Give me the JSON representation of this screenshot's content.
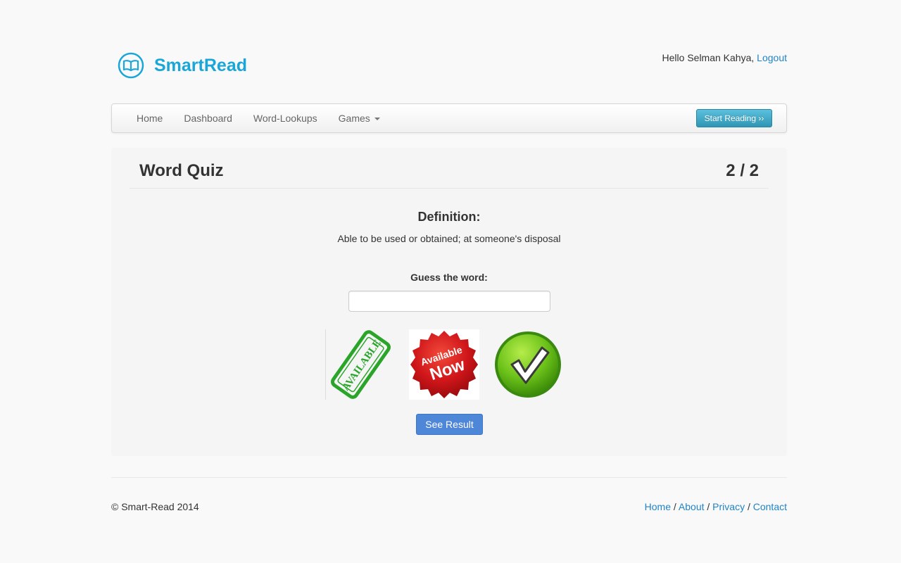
{
  "brand": {
    "name": "SmartRead",
    "icon": "open-book-icon",
    "color": "#1aa6d8"
  },
  "user": {
    "greeting": "Hello Selman Kahya,",
    "logout_label": "Logout"
  },
  "nav": {
    "items": [
      {
        "label": "Home"
      },
      {
        "label": "Dashboard"
      },
      {
        "label": "Word-Lookups"
      },
      {
        "label": "Games"
      }
    ],
    "start_button": "Start Reading ››"
  },
  "quiz": {
    "title": "Word Quiz",
    "progress": "2 / 2",
    "definition_label": "Definition:",
    "definition_text": "Able to be used or obtained; at someone's disposal",
    "guess_label": "Guess the word:",
    "guess_value": "",
    "images": [
      {
        "icon": "available-stamp-icon",
        "text": "AVAILABLE"
      },
      {
        "icon": "available-now-badge-icon",
        "text_top": "Available",
        "text_bottom": "Now"
      },
      {
        "icon": "green-checkmark-icon"
      }
    ],
    "submit_label": "See Result"
  },
  "footer": {
    "copyright": "© Smart-Read 2014",
    "links": [
      "Home",
      "About",
      "Privacy",
      "Contact"
    ],
    "separator": " / "
  },
  "colors": {
    "link": "#1f84c8",
    "primary_button": "#4e86d8",
    "info_button": "#2f96b4"
  }
}
